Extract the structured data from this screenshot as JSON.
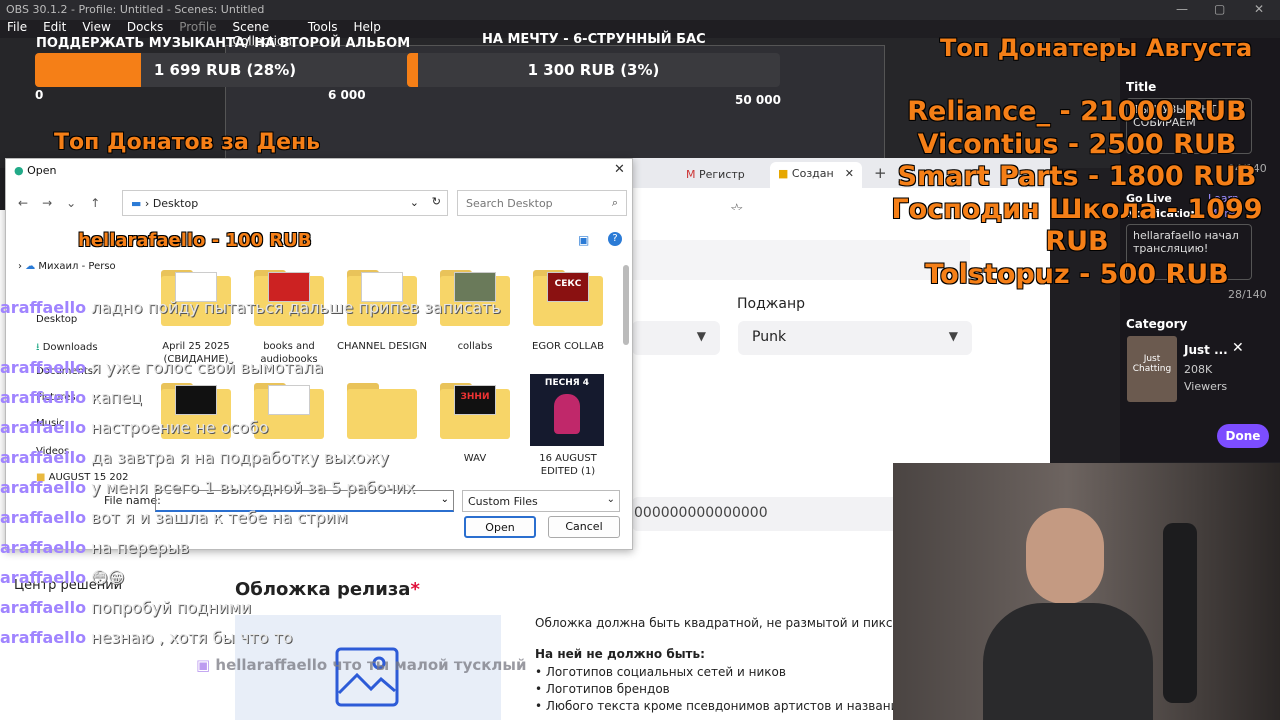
{
  "window": {
    "title": "OBS 30.1.2 - Profile: Untitled - Scenes: Untitled"
  },
  "menu": [
    "File",
    "Edit",
    "View",
    "Docks",
    "Profile",
    "Scene Collection",
    "Tools",
    "Help"
  ],
  "goals": {
    "left_title": "ПОДДЕРЖАТЬ МУЗЫКАНТА/ НА ВТОРОЙ АЛЬБОМ",
    "left_bar_text": "1 699 RUB (28%)",
    "left_progress": 0.28,
    "left_ticks": [
      "0",
      "6 000"
    ],
    "right_title": "НА МЕЧТУ - 6-СТРУННЫЙ БАС",
    "right_bar_text": "1 300 RUB (3%)",
    "right_progress": 0.03,
    "right_ticks": [
      "50 000"
    ]
  },
  "top_day": {
    "title": "Топ Донатов за День"
  },
  "top_month": {
    "title": "Топ Донатеры Августа",
    "entries": [
      "Reliance_ - 21000 RUB",
      "Vicontius - 2500 RUB",
      "Smart Parts - 1800 RUB",
      "Господин Школа - 1099 RUB",
      "Tolstopuz - 500 RUB"
    ]
  },
  "day_donation": "hellarafaello - 100 RUB",
  "browser": {
    "tabs": [
      "Регистр",
      "Создан"
    ],
    "new_tab": "+"
  },
  "stream_panel": {
    "title_label": "Title",
    "title_value": "ТЫ МУЗЫКАНТ. СОБИРАЕМ",
    "title_count": "94/140",
    "go_live_label": "Go Live Notification",
    "go_live_link": "Learn More",
    "go_live_value": "hellarafaello начал трансляцию!",
    "go_live_count": "28/140",
    "category_label": "Category",
    "category_name": "Just ...",
    "category_viewers": "208K",
    "category_viewers_label": "Viewers",
    "category_thumb_text": "Just Chatting",
    "done_button": "Done"
  },
  "page": {
    "subgenre_label": "Поджанр",
    "subgenre_value": "Punk",
    "code_value": "000000000000000",
    "cover_title": "Обложка релиза",
    "cover_required": "*",
    "cover_desc": "Обложка должна быть квадратной, не размытой и пиксельной",
    "must_not_title": "На ней не должно быть:",
    "must_not_items": [
      "Логотипов социальных сетей и ников",
      "Логотипов брендов",
      "Любого текста кроме псевдонимов артистов и названия"
    ],
    "help_center": "Центр решений"
  },
  "dialog": {
    "title": "Open",
    "path": "Desktop",
    "search_placeholder": "Search Desktop",
    "nav_items": [
      "Михаил - Perso",
      "Desktop",
      "Downloads",
      "Documents",
      "Pictures",
      "Music",
      "Videos",
      "AUGUST 15 202"
    ],
    "files": [
      {
        "name": "April 25 2025 (СВИДАНИЕ)",
        "thumb": "СВИДАНИЕ"
      },
      {
        "name": "books and audiobooks",
        "thumb": ""
      },
      {
        "name": "CHANNEL DESIGN",
        "thumb": ""
      },
      {
        "name": "collabs",
        "thumb": ""
      },
      {
        "name": "EGOR COLLAB",
        "thumb": "СЕКС"
      },
      {
        "name": "",
        "thumb": ""
      },
      {
        "name": "",
        "thumb": ""
      },
      {
        "name": "",
        "thumb": ""
      },
      {
        "name": "WAV",
        "thumb": "ЗННИ"
      },
      {
        "name": "16 AUGUST EDITED (1)",
        "thumb": "ПЕСНЯ 4"
      }
    ],
    "file_name_label": "File name:",
    "file_type": "Custom Files",
    "open_button": "Open",
    "cancel_button": "Cancel"
  },
  "chat": [
    {
      "user": "araffaello",
      "message": "ладно пойду пытаться дальше припев записать"
    },
    {
      "user": "araffaello",
      "message": "я уже голос свой вымотала"
    },
    {
      "user": "araffaello",
      "message": "капец"
    },
    {
      "user": "araffaello",
      "message": "настроение не особо"
    },
    {
      "user": "araffaello",
      "message": "да завтра я на подработку выхожу"
    },
    {
      "user": "araffaello",
      "message": "у меня всего 1 выходной за 5 рабочих"
    },
    {
      "user": "araffaello",
      "message": "вот я и зашла к тебе на стрим"
    },
    {
      "user": "araffaello",
      "message": "на перерыв"
    },
    {
      "user": "araffaello",
      "message": "😳😁"
    },
    {
      "user": "araffaello",
      "message": "попробуй подними"
    },
    {
      "user": "araffaello",
      "message": "незнаю , хотя бы что то"
    }
  ],
  "alert": {
    "user": "hellaraffaello",
    "message": "что ты малой тусклый"
  },
  "colors": {
    "accent": "#f57f17",
    "chat_name": "#a084ff",
    "done": "#7c4dff"
  }
}
